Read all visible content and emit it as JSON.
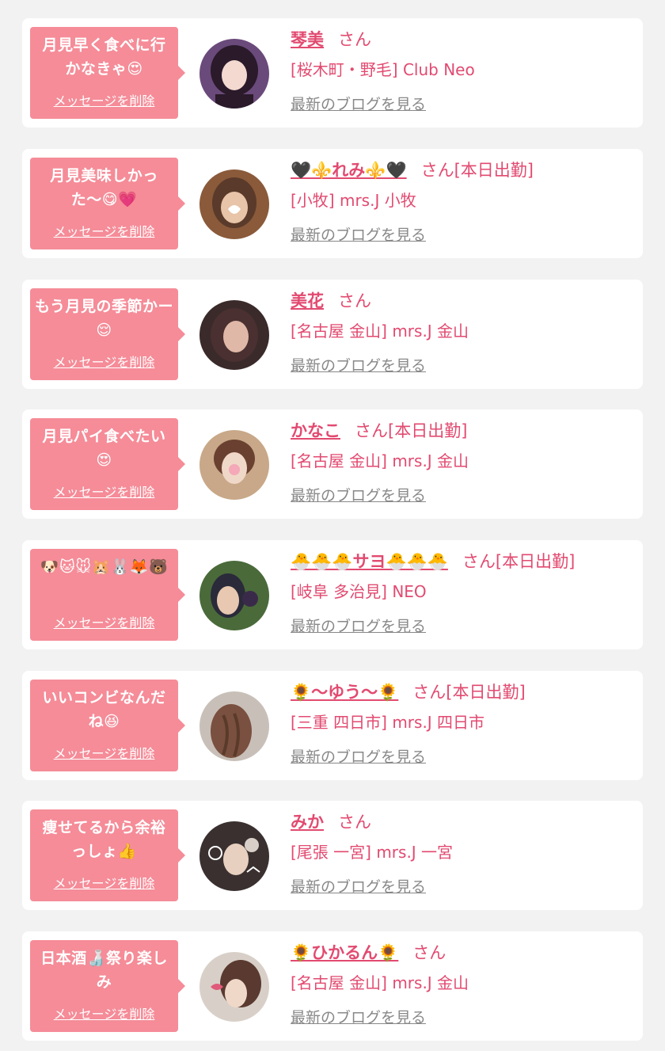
{
  "messages": [
    {
      "bubble_text": "月見早く食べに行かなきゃ😍",
      "delete_label": "メッセージを削除",
      "name": "琴美",
      "suffix": "さん",
      "shop": "[桜木町・野毛] Club Neo",
      "blog_label": "最新のブログを見る",
      "avatar_colors": [
        "#6a4a7a",
        "#f3d9d0",
        "#2a1a2a"
      ]
    },
    {
      "bubble_text": "月見美味しかった〜😋💗",
      "delete_label": "メッセージを削除",
      "name": "🖤⚜️れみ⚜️🖤",
      "suffix": "さん[本日出勤]",
      "shop": "[小牧] mrs.J 小牧",
      "blog_label": "最新のブログを見る",
      "avatar_colors": [
        "#8a5a3a",
        "#e8c4a8",
        "#5a3a2a"
      ]
    },
    {
      "bubble_text": "もう月見の季節かー😌",
      "delete_label": "メッセージを削除",
      "name": "美花",
      "suffix": "さん",
      "shop": "[名古屋 金山] mrs.J 金山",
      "blog_label": "最新のブログを見る",
      "avatar_colors": [
        "#3a2a2a",
        "#e0b8a8",
        "#4a3030"
      ]
    },
    {
      "bubble_text": "月見パイ食べたい😍",
      "delete_label": "メッセージを削除",
      "name": "かなこ",
      "suffix": "さん[本日出勤]",
      "shop": "[名古屋 金山] mrs.J 金山",
      "blog_label": "最新のブログを見る",
      "avatar_colors": [
        "#c8a888",
        "#f0d8c8",
        "#6a4030"
      ]
    },
    {
      "bubble_text": "🐶🐱🐭🐹🐰🦊🐻",
      "delete_label": "メッセージを削除",
      "name": "🐣🐣🐣サヨ🐣🐣🐣",
      "suffix": "さん[本日出勤]",
      "shop": "[岐阜 多治見] NEO",
      "blog_label": "最新のブログを見る",
      "avatar_colors": [
        "#4a6a3a",
        "#e8c8b0",
        "#2a2a3a"
      ]
    },
    {
      "bubble_text": "いいコンビなんだね😆",
      "delete_label": "メッセージを削除",
      "name": "🌻〜ゆう〜🌻",
      "suffix": "さん[本日出勤]",
      "shop": "[三重 四日市] mrs.J 四日市",
      "blog_label": "最新のブログを見る",
      "avatar_colors": [
        "#c8c0b8",
        "#7a5040",
        "#5a3a2a"
      ]
    },
    {
      "bubble_text": "痩せてるから余裕っしょ👍",
      "delete_label": "メッセージを削除",
      "name": "みか",
      "suffix": "さん",
      "shop": "[尾張 一宮] mrs.J 一宮",
      "blog_label": "最新のブログを見る",
      "avatar_colors": [
        "#3a3030",
        "#e8d0c0",
        "#ffffff"
      ]
    },
    {
      "bubble_text": "日本酒🍶祭り楽しみ",
      "delete_label": "メッセージを削除",
      "name": "🌻ひかるん🌻",
      "suffix": "さん",
      "shop": "[名古屋 金山] mrs.J 金山",
      "blog_label": "最新のブログを見る",
      "avatar_colors": [
        "#d8d0c8",
        "#5a3a30",
        "#e05a7a"
      ]
    }
  ]
}
